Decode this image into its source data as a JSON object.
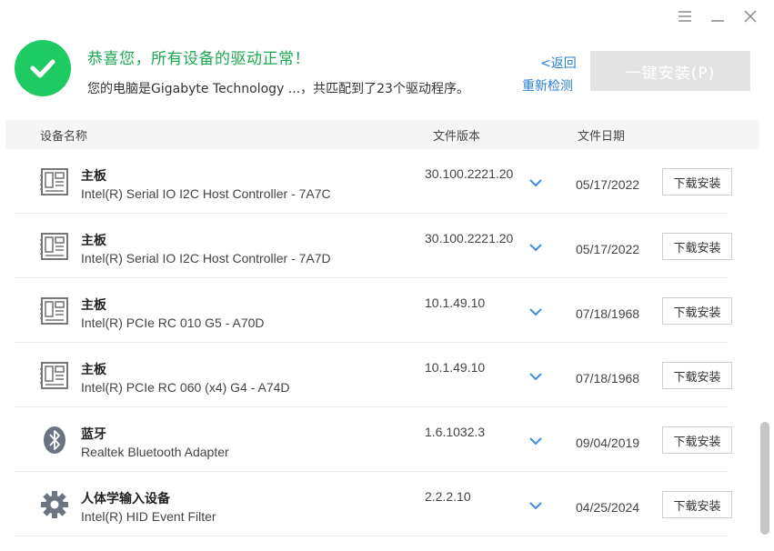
{
  "window": {
    "menu_icon": "menu-icon",
    "minimize_icon": "minimize-icon",
    "close_icon": "close-icon"
  },
  "header": {
    "status_icon": "check-icon",
    "status_color": "#1ecb62",
    "title": "恭喜您，所有设备的驱动正常！",
    "subtitle": "您的电脑是Gigabyte Technology ...，共匹配到了23个驱动程序。",
    "back_link": "<返回",
    "redetect_link": "重新检测",
    "install_all_label": "一键安装(P)"
  },
  "columns": {
    "name": "设备名称",
    "version": "文件版本",
    "date": "文件日期"
  },
  "drivers": [
    {
      "icon": "motherboard-icon",
      "category": "主板",
      "device": "Intel(R) Serial IO I2C Host Controller - 7A7C",
      "version": "30.100.2221.20",
      "date": "05/17/2022",
      "action": "下载安装"
    },
    {
      "icon": "motherboard-icon",
      "category": "主板",
      "device": "Intel(R) Serial IO I2C Host Controller - 7A7D",
      "version": "30.100.2221.20",
      "date": "05/17/2022",
      "action": "下载安装"
    },
    {
      "icon": "motherboard-icon",
      "category": "主板",
      "device": "Intel(R) PCIe RC 010 G5 - A70D",
      "version": "10.1.49.10",
      "date": "07/18/1968",
      "action": "下载安装"
    },
    {
      "icon": "motherboard-icon",
      "category": "主板",
      "device": "Intel(R) PCIe RC 060 (x4) G4 - A74D",
      "version": "10.1.49.10",
      "date": "07/18/1968",
      "action": "下载安装"
    },
    {
      "icon": "bluetooth-icon",
      "category": "蓝牙",
      "device": "Realtek Bluetooth Adapter",
      "version": "1.6.1032.3",
      "date": "09/04/2019",
      "action": "下载安装"
    },
    {
      "icon": "gear-icon",
      "category": "人体学输入设备",
      "device": "Intel(R) HID Event Filter",
      "version": "2.2.2.10",
      "date": "04/25/2024",
      "action": "下载安装"
    }
  ],
  "colors": {
    "accent_link": "#2a7fd8",
    "chevron": "#3a8ee6",
    "disabled_button": "#e3e3e3"
  }
}
